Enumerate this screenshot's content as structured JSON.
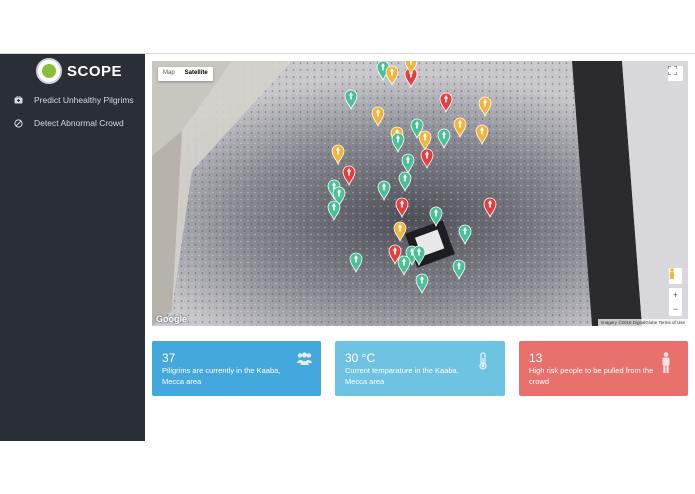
{
  "brand": {
    "name": "SCOPE"
  },
  "sidebar": {
    "items": [
      {
        "label": "Predict Unhealthy Pilgrims",
        "icon": "medkit-icon"
      },
      {
        "label": "Detect Abnormal Crowd",
        "icon": "ban-icon"
      }
    ]
  },
  "map": {
    "type_options": [
      "Map",
      "Satellite"
    ],
    "selected_type": "Satellite",
    "google_label": "Google",
    "attribution": "Imagery ©2018 DigitalGlobe   Terms of Use",
    "zoom_in": "+",
    "zoom_out": "−",
    "marker_colors": {
      "green": "#4bbf95",
      "yellow": "#f3b43c",
      "red": "#e2403e"
    }
  },
  "cards": [
    {
      "value": "37",
      "text": "Piligrims are currently in the Kaaba, Mecca area",
      "color": "#45a8dc",
      "icon": "users-icon"
    },
    {
      "value": "30 °C",
      "text": "Current temparature in the Kaaba, Mecca area",
      "color": "#6ec2e2",
      "icon": "thermometer-icon"
    },
    {
      "value": "13",
      "text": "High risk people to be pulled from the crowd",
      "color": "#e8716e",
      "icon": "person-icon"
    }
  ]
}
